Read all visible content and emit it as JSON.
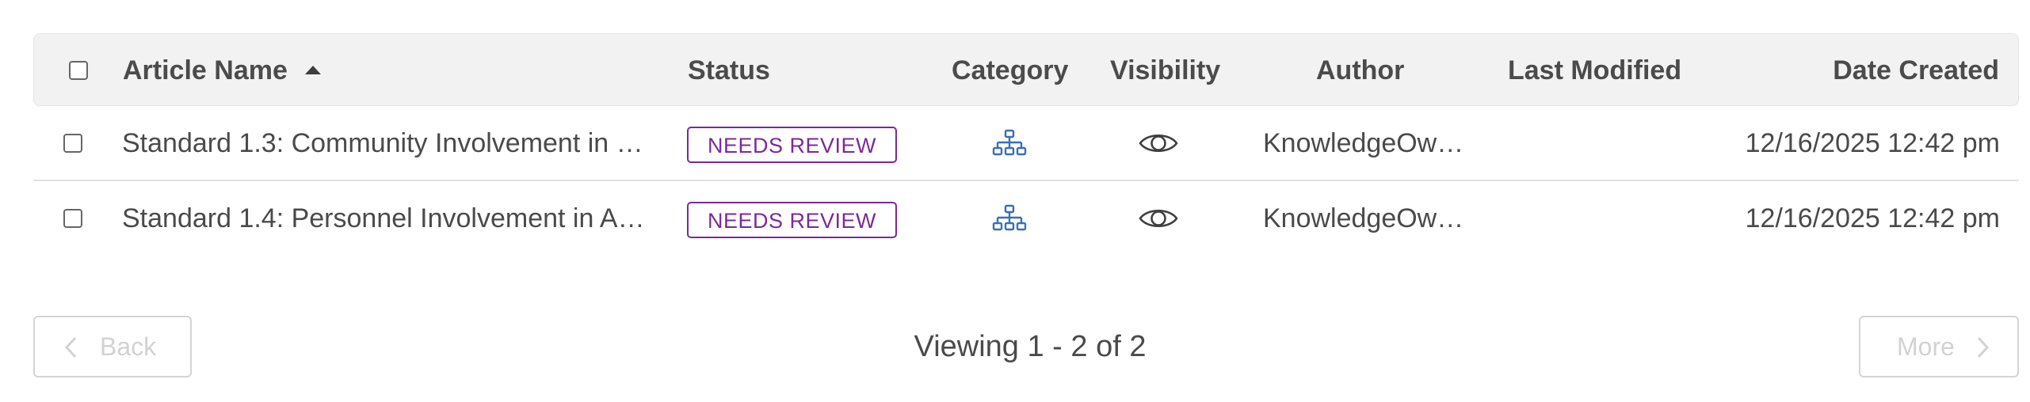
{
  "header": {
    "columns": {
      "article_name": "Article Name",
      "status": "Status",
      "category": "Category",
      "visibility": "Visibility",
      "author": "Author",
      "last_modified": "Last Modified",
      "date_created": "Date Created"
    },
    "sort_column": "Article Name",
    "sort_direction": "ascending"
  },
  "rows": [
    {
      "article_name": "Standard 1.3: Community Involvement in …",
      "status": "NEEDS REVIEW",
      "category_icon": "hierarchy-icon",
      "visibility_icon": "eye-icon",
      "author": "KnowledgeOw…",
      "last_modified": "",
      "date_created": "12/16/2025 12:42 pm"
    },
    {
      "article_name": "Standard 1.4: Personnel Involvement in A…",
      "status": "NEEDS REVIEW",
      "category_icon": "hierarchy-icon",
      "visibility_icon": "eye-icon",
      "author": "KnowledgeOw…",
      "last_modified": "",
      "date_created": "12/16/2025 12:42 pm"
    }
  ],
  "pagination": {
    "back_label": "Back",
    "more_label": "More",
    "viewing_text": "Viewing 1 - 2 of 2"
  },
  "colors": {
    "status_badge": "#7b2a98",
    "category_icon": "#3a6fb5",
    "header_bg": "#f2f2f2",
    "disabled_text": "#d2d2d2"
  }
}
